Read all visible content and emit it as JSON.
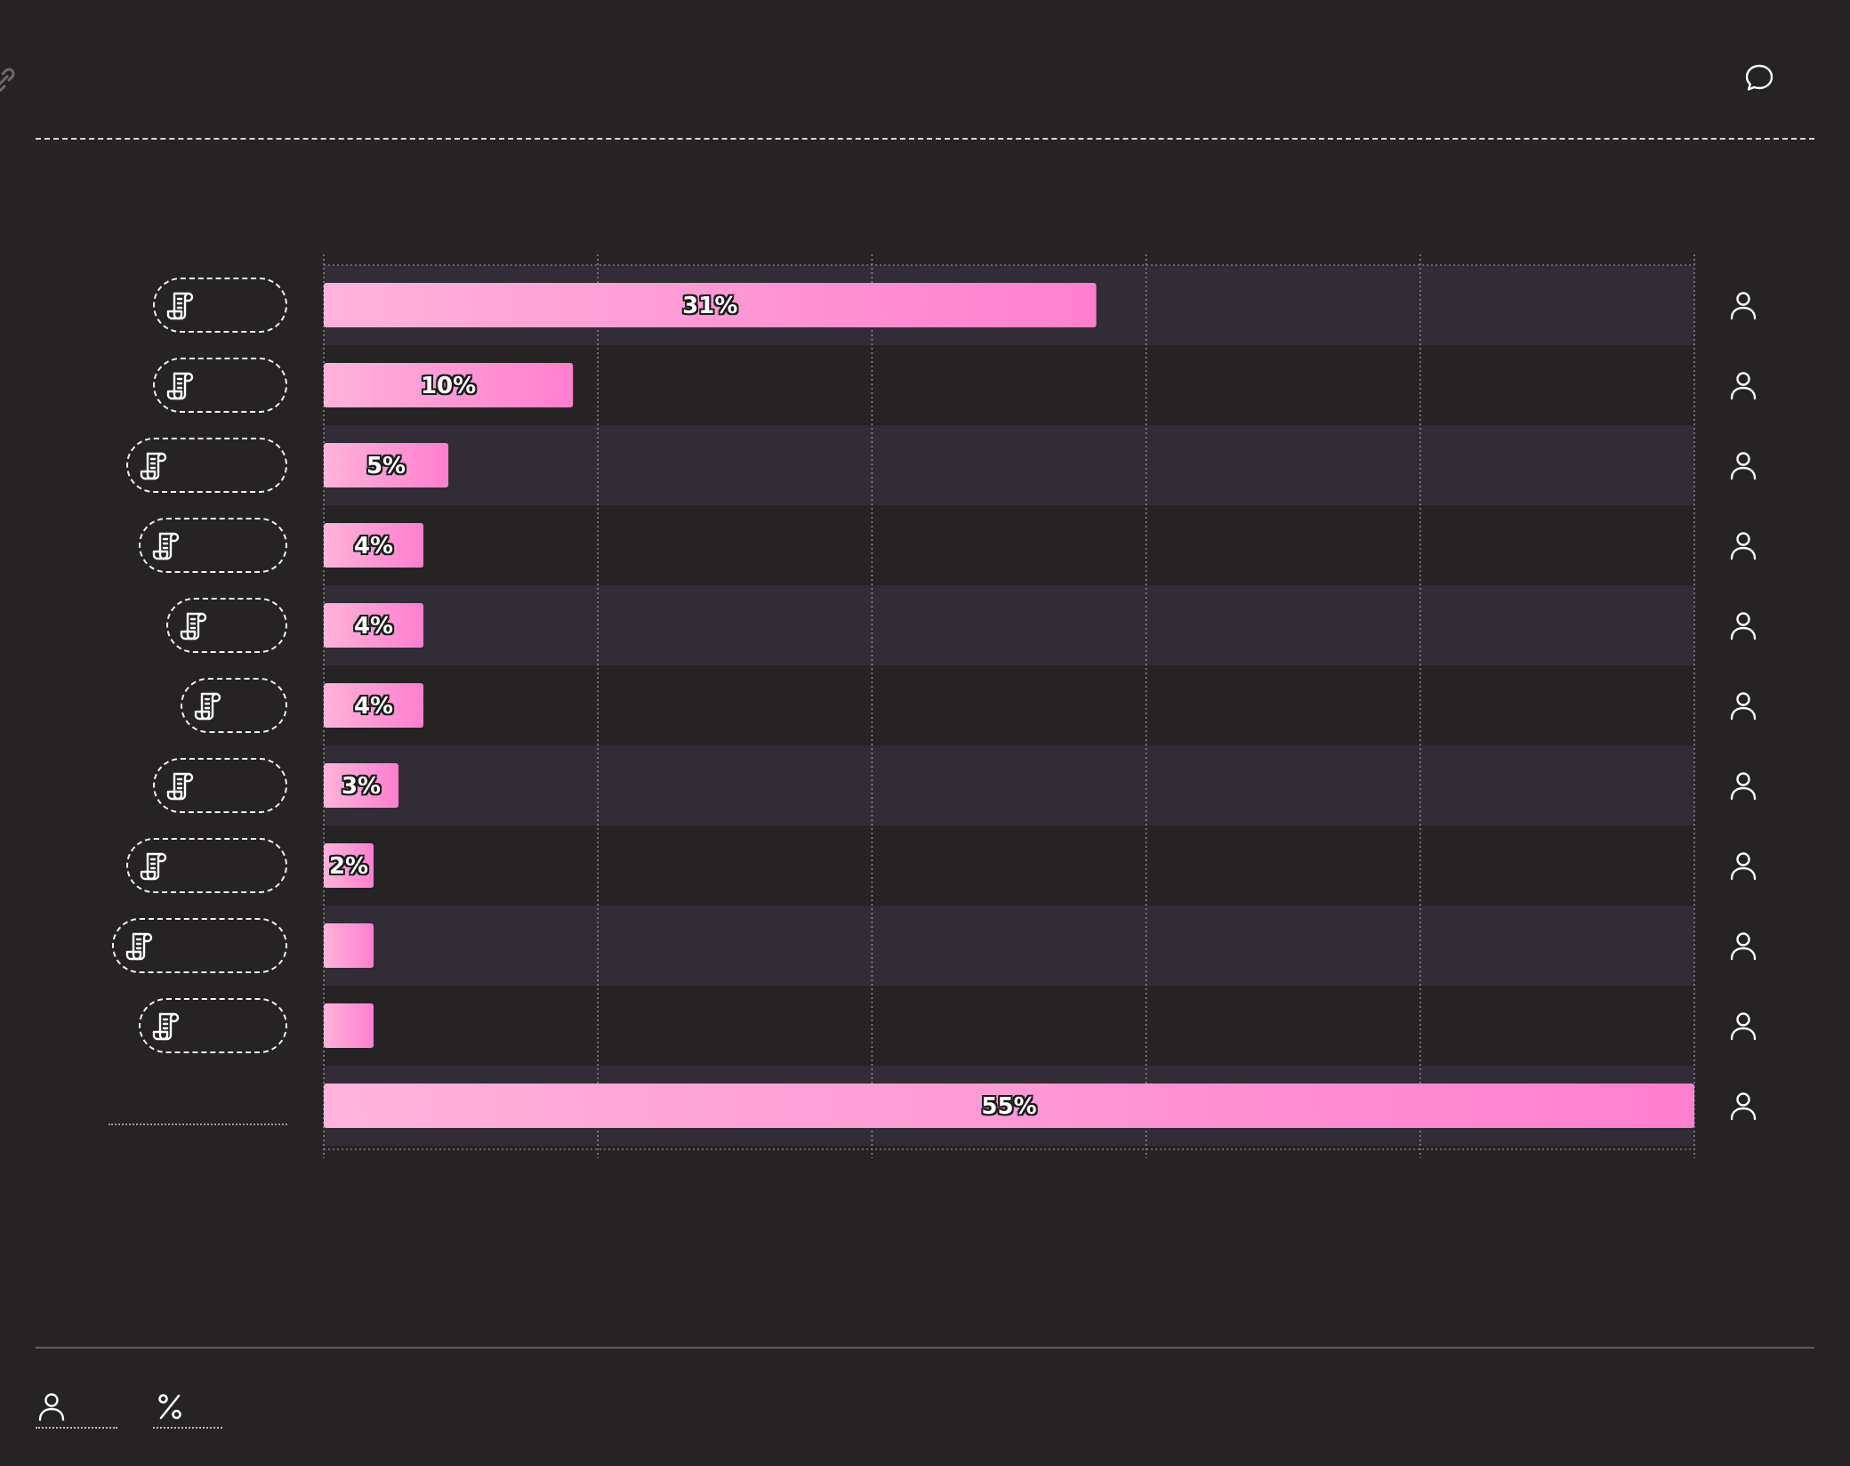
{
  "header": {
    "left_icon": "link-icon",
    "right_icon": "chat-bubble-icon"
  },
  "colors": {
    "background": "#262325",
    "band": "#312c36",
    "bar_start": "#ffb3da",
    "bar_end": "#ff7fcf",
    "grid": "#8a8a8a",
    "text": "#ffffff"
  },
  "chart_data": {
    "type": "bar",
    "orientation": "horizontal",
    "values": [
      31,
      10,
      5,
      4,
      4,
      4,
      3,
      2,
      2,
      2,
      55
    ],
    "data_labels": [
      "31%",
      "10%",
      "5%",
      "4%",
      "4%",
      "4%",
      "3%",
      "2%",
      "",
      "",
      "55%"
    ],
    "row_icons": [
      "scroll-icon",
      "scroll-icon",
      "scroll-icon",
      "scroll-icon",
      "scroll-icon",
      "scroll-icon",
      "scroll-icon",
      "scroll-icon",
      "scroll-icon",
      "scroll-icon",
      ""
    ],
    "right_icons": [
      "user-icon",
      "user-icon",
      "user-icon",
      "user-icon",
      "user-icon",
      "user-icon",
      "user-icon",
      "user-icon",
      "user-icon",
      "user-icon",
      "user-icon"
    ],
    "xlim": [
      0,
      55
    ],
    "grid": true,
    "alternating_bands": true,
    "title": "",
    "xlabel": "",
    "ylabel": ""
  },
  "legend": {
    "items": [
      {
        "icon": "user-icon",
        "label": ""
      },
      {
        "icon": "percent-icon",
        "label": ""
      }
    ]
  }
}
